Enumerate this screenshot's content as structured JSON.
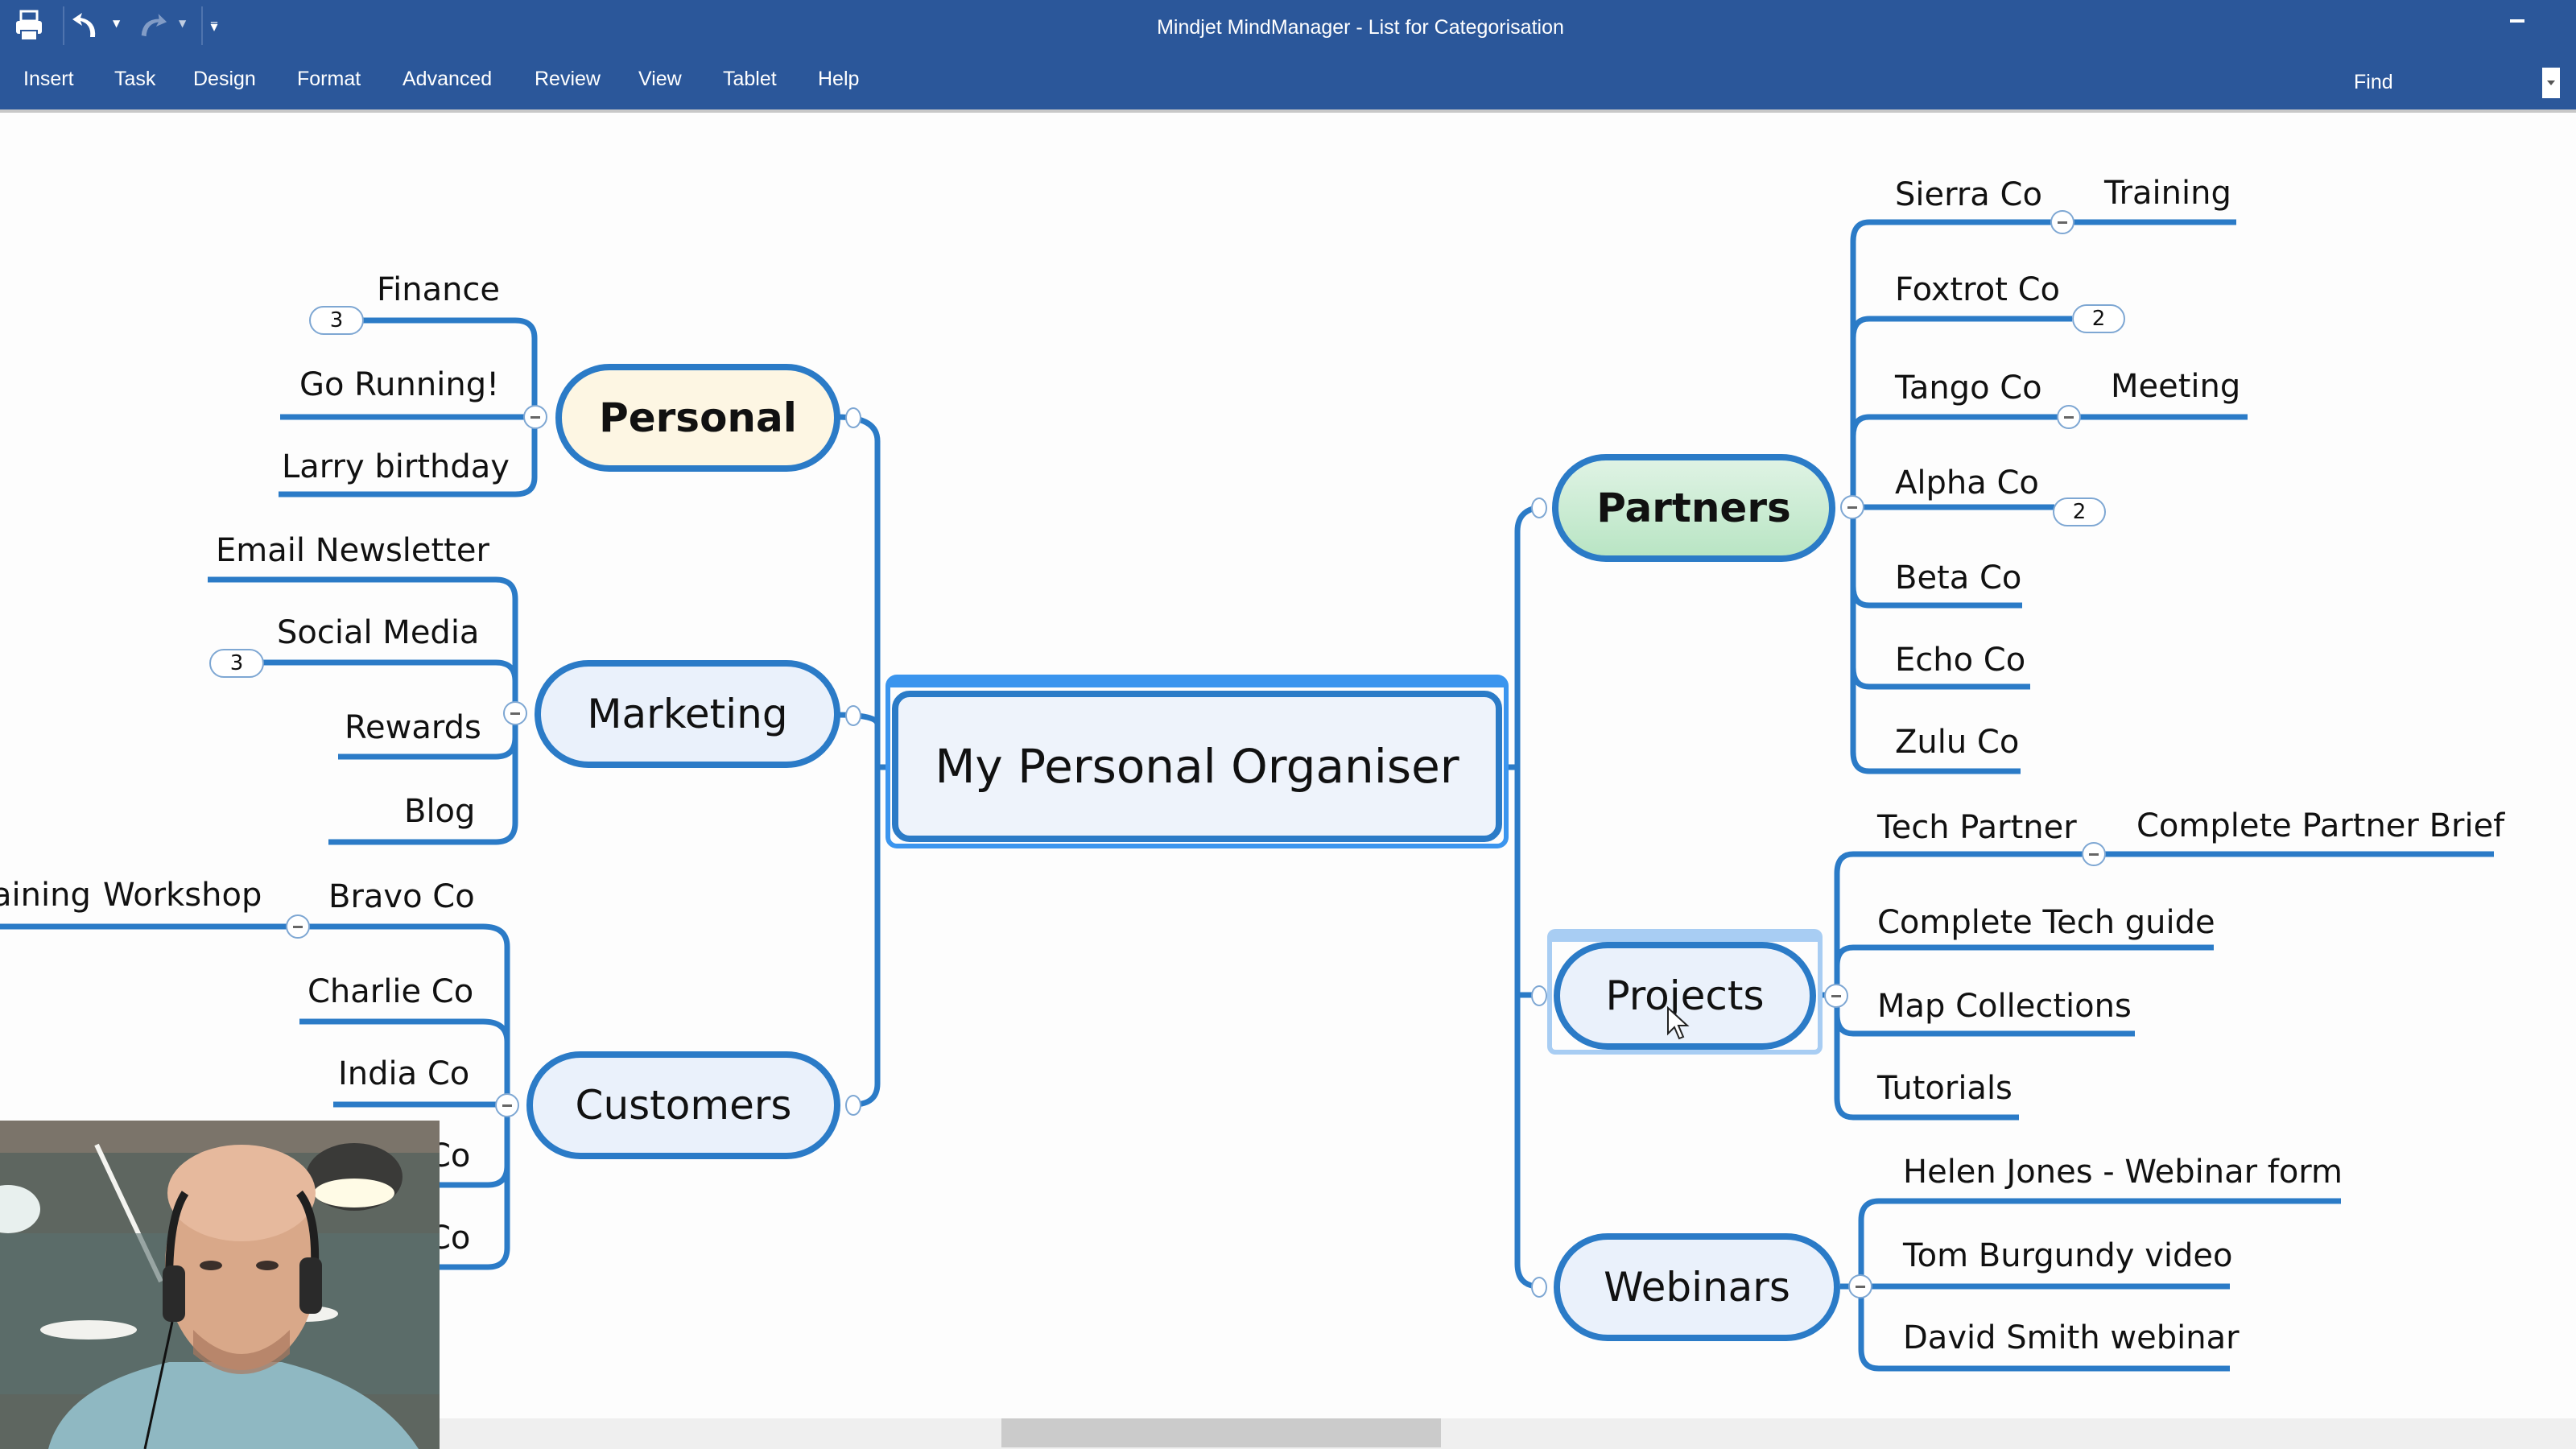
{
  "window": {
    "title": "Mindjet MindManager - List for Categorisation",
    "quick_access": [
      "print-icon",
      "undo-icon",
      "redo-icon",
      "customize-quick-access-icon"
    ]
  },
  "menu": {
    "items": [
      "Insert",
      "Task",
      "Design",
      "Format",
      "Advanced",
      "Review",
      "View",
      "Tablet",
      "Help"
    ],
    "find_label": "Find"
  },
  "colors": {
    "titlebar": "#2b579a",
    "branch": "#2b7bc7",
    "selection": "#3b95ee",
    "personal_fill": "#fdf6e3",
    "partners_fill": "#c6ebcf",
    "topic_fill": "#eaf1fb"
  },
  "map": {
    "central": "My Personal Organiser",
    "left": {
      "personal": {
        "label": "Personal",
        "children": [
          {
            "label": "Finance",
            "badge": "3"
          },
          {
            "label": "Go Running!"
          },
          {
            "label": "Larry birthday"
          }
        ]
      },
      "marketing": {
        "label": "Marketing",
        "children": [
          {
            "label": "Email Newsletter"
          },
          {
            "label": "Social Media",
            "badge": "3"
          },
          {
            "label": "Rewards"
          },
          {
            "label": "Blog"
          }
        ]
      },
      "customers": {
        "label": "Customers",
        "children": [
          {
            "label": "Bravo Co",
            "subchildren": [
              "Workshop",
              "aining"
            ]
          },
          {
            "label": "Charlie Co"
          },
          {
            "label": "India Co"
          },
          {
            "label": "Co"
          },
          {
            "label": "Co"
          }
        ]
      }
    },
    "right": {
      "partners": {
        "label": "Partners",
        "children": [
          {
            "label": "Sierra Co",
            "subchildren": [
              "Training"
            ]
          },
          {
            "label": "Foxtrot Co",
            "badge": "2"
          },
          {
            "label": "Tango Co",
            "subchildren": [
              "Meeting"
            ]
          },
          {
            "label": "Alpha Co",
            "badge": "2"
          },
          {
            "label": "Beta Co"
          },
          {
            "label": "Echo Co"
          },
          {
            "label": "Zulu Co"
          }
        ]
      },
      "projects": {
        "label": "Projects",
        "children": [
          {
            "label": "Tech Partner",
            "subchildren": [
              "Complete Partner Brief"
            ]
          },
          {
            "label": "Complete Tech guide"
          },
          {
            "label": "Map Collections"
          },
          {
            "label": "Tutorials"
          }
        ]
      },
      "webinars": {
        "label": "Webinars",
        "children": [
          {
            "label": "Helen Jones - Webinar form"
          },
          {
            "label": "Tom Burgundy video"
          },
          {
            "label": "David Smith webinar"
          }
        ]
      }
    }
  },
  "webcam": {
    "description": "presenter webcam overlay"
  }
}
